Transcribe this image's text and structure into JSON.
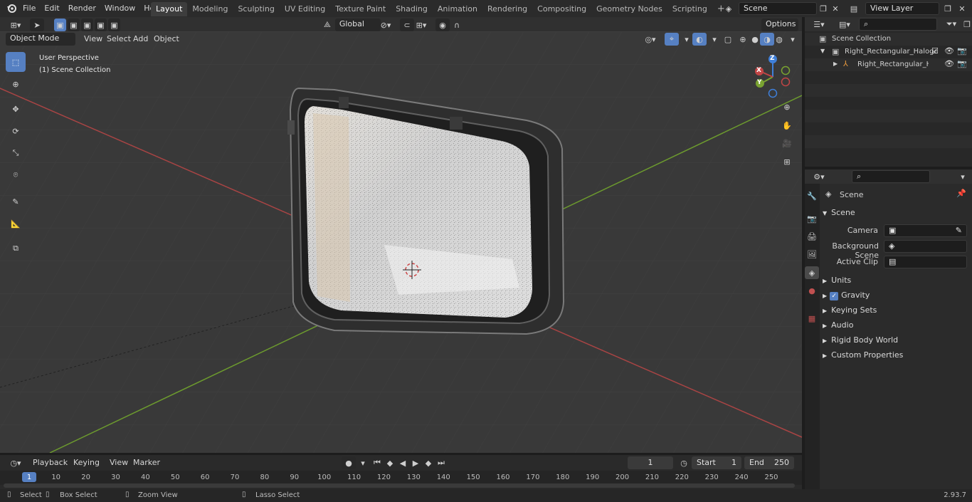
{
  "top_menu": [
    "File",
    "Edit",
    "Render",
    "Window",
    "Help"
  ],
  "workspaces": [
    "Layout",
    "Modeling",
    "Sculpting",
    "UV Editing",
    "Texture Paint",
    "Shading",
    "Animation",
    "Rendering",
    "Compositing",
    "Geometry Nodes",
    "Scripting"
  ],
  "active_workspace": "Layout",
  "scene_name": "Scene",
  "view_layer": "View Layer",
  "viewport": {
    "mode": "Object Mode",
    "menus": [
      "View",
      "Select",
      "Add",
      "Object"
    ],
    "transform_orientation": "Global",
    "options_label": "Options",
    "overlay_line1": "User Perspective",
    "overlay_line2": "(1) Scene Collection",
    "gizmo_axes": {
      "z": "Z",
      "y": "Y",
      "x": "X"
    }
  },
  "outliner": {
    "root": "Scene Collection",
    "items": [
      "Right_Rectangular_Halogen_l",
      "Right_Rectangular_Haloc"
    ]
  },
  "properties": {
    "header": "Scene",
    "section": "Scene",
    "fields": {
      "camera_label": "Camera",
      "background_scene_label": "Background Scene",
      "active_clip_label": "Active Clip"
    },
    "sections": [
      "Units",
      "Gravity",
      "Keying Sets",
      "Audio",
      "Rigid Body World",
      "Custom Properties"
    ],
    "gravity_checked": true
  },
  "timeline": {
    "menus": [
      "Playback",
      "Keying",
      "View",
      "Marker"
    ],
    "current_frame": "1",
    "start_label": "Start",
    "start_value": "1",
    "end_label": "End",
    "end_value": "250",
    "ticks": [
      "1",
      "10",
      "20",
      "30",
      "40",
      "50",
      "60",
      "70",
      "80",
      "90",
      "100",
      "110",
      "120",
      "130",
      "140",
      "150",
      "160",
      "170",
      "180",
      "190",
      "200",
      "210",
      "220",
      "230",
      "240",
      "250"
    ]
  },
  "statusbar": {
    "items": [
      "Select",
      "Box Select",
      "Zoom View",
      "Lasso Select"
    ],
    "version": "2.93.7"
  },
  "colors": {
    "accent": "#5680c2",
    "x_axis": "#c24545",
    "y_axis": "#7aa331",
    "z_axis": "#3f7fd9"
  }
}
